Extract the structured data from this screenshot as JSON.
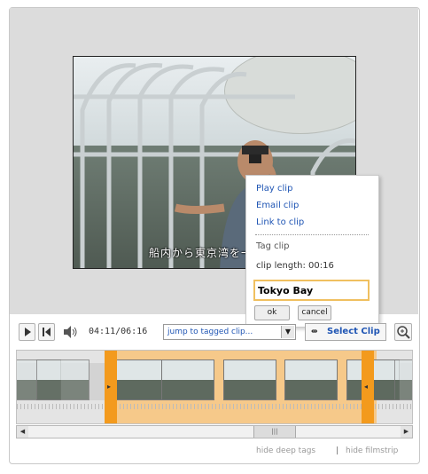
{
  "popup": {
    "play_clip": "Play clip",
    "email_clip": "Email clip",
    "link_to_clip": "Link to clip",
    "tag_clip": "Tag clip",
    "clip_length": "clip length: 00:16",
    "tag_input_value": "Tokyo Bay",
    "ok_label": "ok",
    "cancel_label": "cancel"
  },
  "video": {
    "subtitle": "船内から東京湾を一"
  },
  "controls": {
    "timecode": "04:11/06:16",
    "jump_select_value": "jump to tagged clip...",
    "select_clip_label": "Select Clip"
  },
  "footer": {
    "hide_deep_tags": "hide deep tags",
    "separator": "|",
    "hide_filmstrip": "hide filmstrip"
  },
  "icons": {
    "play": "play-icon",
    "rewind": "skip-to-start-icon",
    "volume": "speaker-icon",
    "select_clip": "scissors-icon",
    "zoom": "zoom-in-icon"
  },
  "colors": {
    "accent_orange": "#f39a1d",
    "selection_fill": "#f6c98a",
    "link_blue": "#1f55b4",
    "input_border": "#f0c060"
  }
}
